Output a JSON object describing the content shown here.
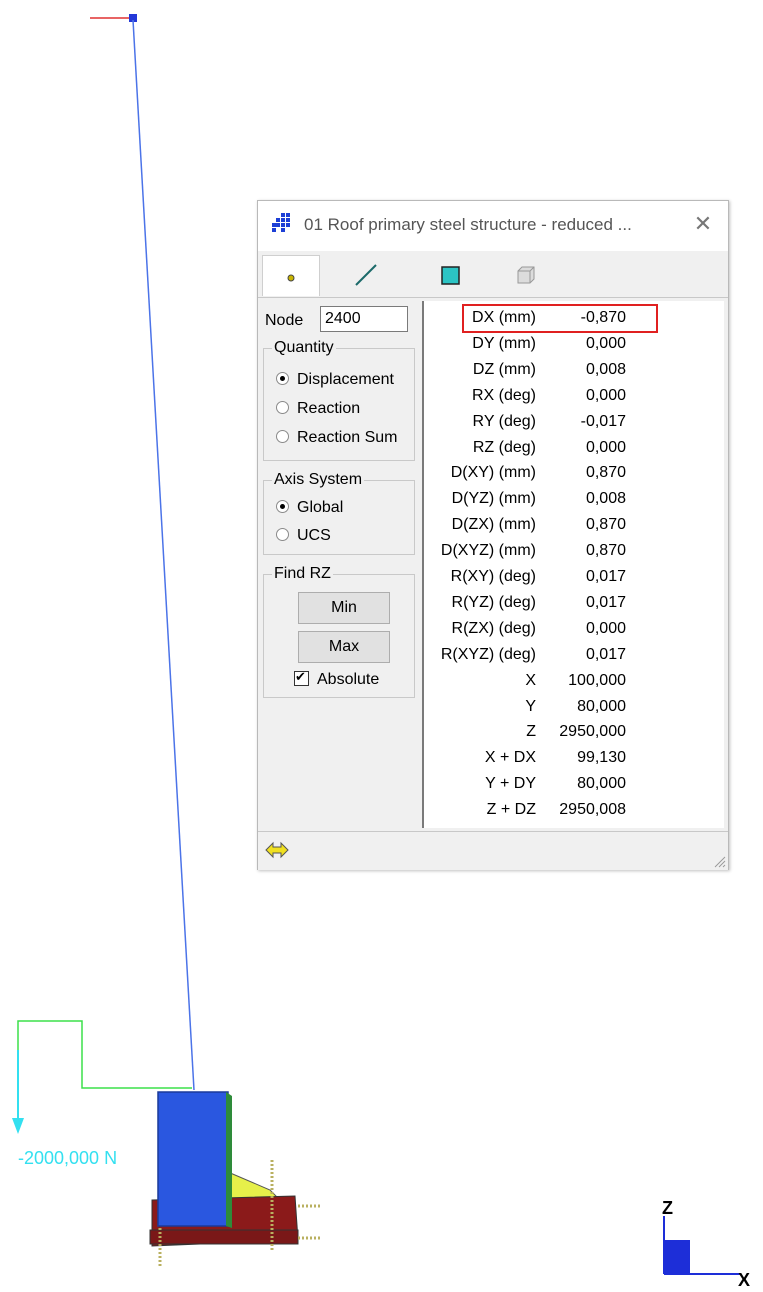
{
  "viewport": {
    "load_label": "-2000,000 N",
    "axis_z_label": "Z",
    "axis_x_label": "X"
  },
  "dialog": {
    "title": "01 Roof primary steel structure - reduced ...",
    "close_glyph": "✕",
    "tabs": [
      {
        "name": "node-tab",
        "icon": "node-dot-icon",
        "active": true
      },
      {
        "name": "member-tab",
        "icon": "line-icon",
        "active": false
      },
      {
        "name": "plate-tab",
        "icon": "square-icon",
        "active": false
      },
      {
        "name": "solid-tab",
        "icon": "cube-icon",
        "active": false
      }
    ],
    "node_label": "Node",
    "node_value": "2400",
    "quantity": {
      "legend": "Quantity",
      "options": [
        "Displacement",
        "Reaction",
        "Reaction Sum"
      ],
      "selected": "Displacement"
    },
    "axis_system": {
      "legend": "Axis System",
      "options": [
        "Global",
        "UCS"
      ],
      "selected": "Global"
    },
    "find": {
      "legend": "Find RZ",
      "min_label": "Min",
      "max_label": "Max",
      "absolute_label": "Absolute",
      "absolute_checked": true
    },
    "results": [
      {
        "name": "DX (mm)",
        "value": "-0,870"
      },
      {
        "name": "DY (mm)",
        "value": "0,000"
      },
      {
        "name": "DZ (mm)",
        "value": "0,008"
      },
      {
        "name": "RX (deg)",
        "value": "0,000"
      },
      {
        "name": "RY (deg)",
        "value": "-0,017"
      },
      {
        "name": "RZ (deg)",
        "value": "0,000"
      },
      {
        "name": "D(XY) (mm)",
        "value": "0,870"
      },
      {
        "name": "D(YZ) (mm)",
        "value": "0,008"
      },
      {
        "name": "D(ZX) (mm)",
        "value": "0,870"
      },
      {
        "name": "D(XYZ) (mm)",
        "value": "0,870"
      },
      {
        "name": "R(XY) (deg)",
        "value": "0,017"
      },
      {
        "name": "R(YZ) (deg)",
        "value": "0,017"
      },
      {
        "name": "R(ZX) (deg)",
        "value": "0,000"
      },
      {
        "name": "R(XYZ) (deg)",
        "value": "0,017"
      },
      {
        "name": "X",
        "value": "100,000"
      },
      {
        "name": "Y",
        "value": "80,000"
      },
      {
        "name": "Z",
        "value": "2950,000"
      },
      {
        "name": "X + DX",
        "value": "99,130"
      },
      {
        "name": "Y + DY",
        "value": "80,000"
      },
      {
        "name": "Z + DZ",
        "value": "2950,008"
      }
    ],
    "highlighted_row": "DX (mm)"
  },
  "colors": {
    "highlight": "#e02020",
    "beam": "#4b73e8",
    "load": "#33e0f0",
    "column": "#2a57e0",
    "plate": "#8b1a1a",
    "stiffener": "#e6f04a"
  }
}
